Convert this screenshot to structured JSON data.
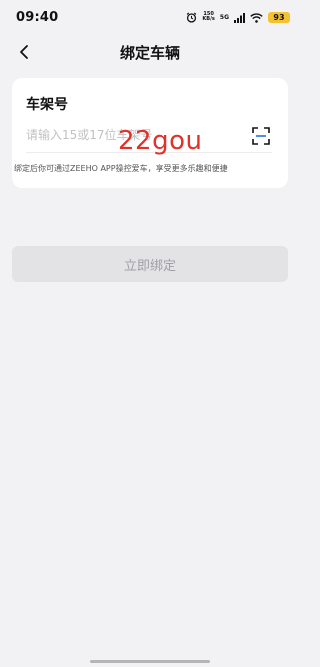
{
  "status_bar": {
    "time": "09:40",
    "net_speed_value": "150",
    "net_speed_unit": "KB/s",
    "network_type": "5G",
    "battery": "93"
  },
  "header": {
    "title": "绑定车辆"
  },
  "form": {
    "label": "车架号",
    "placeholder": "请输入15或17位车架号",
    "hint": "绑定后你可通过ZEEHO APP操控爱车，享受更多乐趣和便捷"
  },
  "watermark": "22gou",
  "bind_button_label": "立即绑定"
}
